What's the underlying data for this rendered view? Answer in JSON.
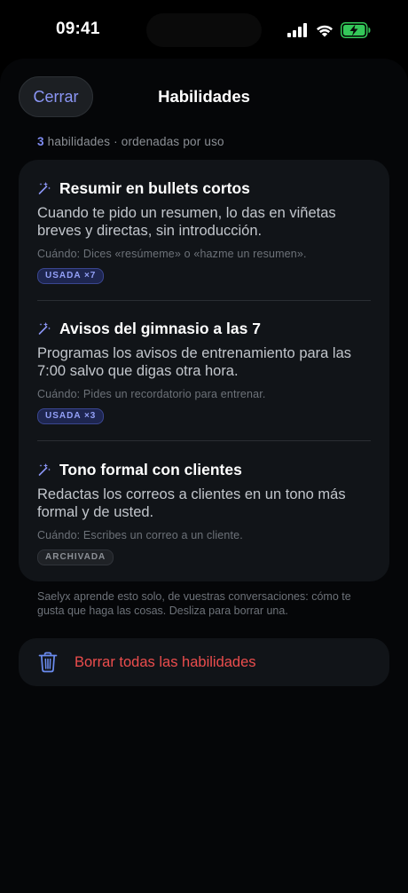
{
  "status_bar": {
    "time": "09:41",
    "icons": [
      "signal-icon",
      "wifi-icon",
      "battery-charging-icon"
    ],
    "battery_color": "#34c759"
  },
  "sheet": {
    "close_label": "Cerrar",
    "title": "Habilidades",
    "summary_count": "3",
    "summary_text": " habilidades · ordenadas por uso"
  },
  "skills": [
    {
      "icon": "magic-wand-icon",
      "title": "Resumir en bullets cortos",
      "description": "Cuando te pido un resumen, lo das en viñetas breves y directas, sin introducción.",
      "when": "Cuándo: Dices «resúmeme» o «hazme un resumen».",
      "badge": "USADA ×7",
      "badge_type": "used"
    },
    {
      "icon": "magic-wand-icon",
      "title": "Avisos del gimnasio a las 7",
      "description": "Programas los avisos de entrenamiento para las 7:00 salvo que digas otra hora.",
      "when": "Cuándo: Pides un recordatorio para entrenar.",
      "badge": "USADA ×3",
      "badge_type": "used"
    },
    {
      "icon": "magic-wand-icon",
      "title": "Tono formal con clientes",
      "description": "Redactas los correos a clientes en un tono más formal y de usted.",
      "when": "Cuándo: Escribes un correo a un cliente.",
      "badge": "ARCHIVADA",
      "badge_type": "archived"
    }
  ],
  "footnote": "Saelyx aprende esto solo, de vuestras conversaciones: cómo te gusta que haga las cosas. Desliza para borrar una.",
  "delete_all": {
    "icon": "trash-icon",
    "label": "Borrar todas las habilidades"
  },
  "colors": {
    "accent": "#8b96f5",
    "danger": "#ec4d4d",
    "card": "#111418",
    "background": "#000000"
  }
}
